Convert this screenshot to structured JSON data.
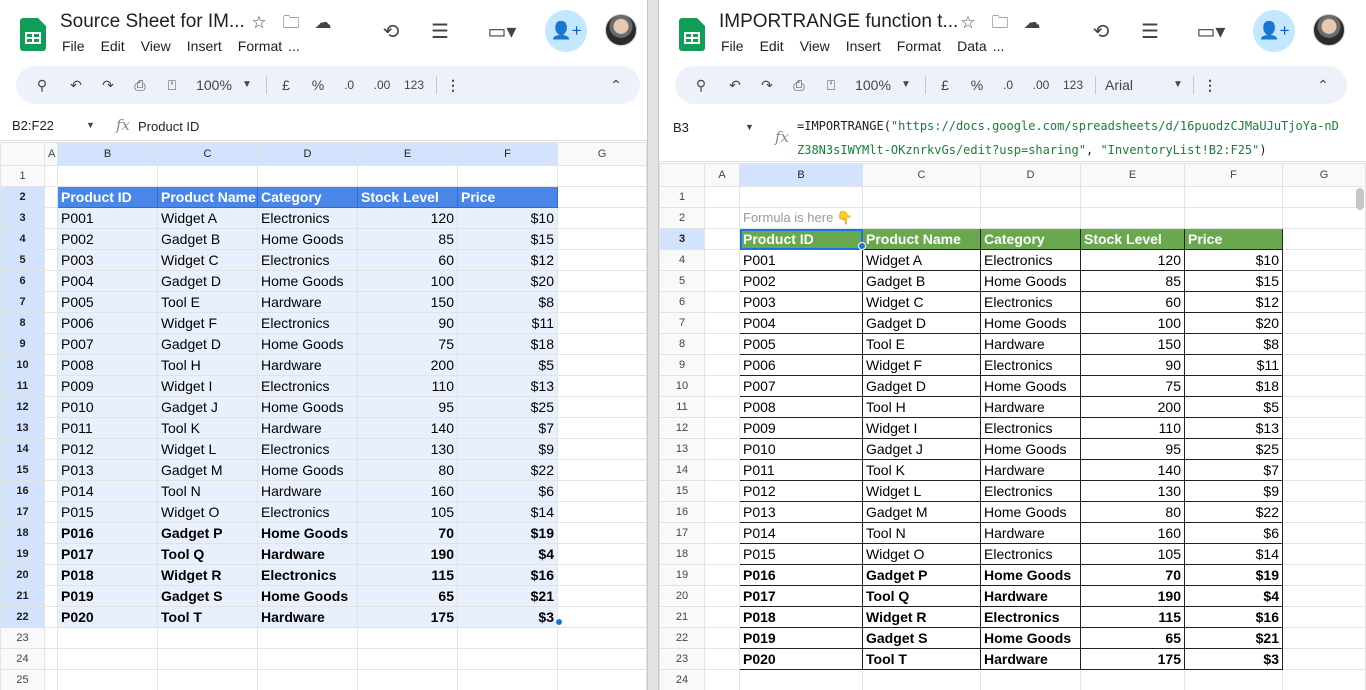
{
  "left": {
    "title": "Source Sheet for IM...",
    "menu": [
      "File",
      "Edit",
      "View",
      "Insert",
      "Format",
      "..."
    ],
    "zoom": "100%",
    "toolbar": {
      "currency": "£",
      "percent": "%",
      "dec_less": ".0",
      "dec_more": ".00",
      "format": "123"
    },
    "name_box": "B2:F22",
    "formula": "Product ID",
    "cols": [
      "A",
      "B",
      "C",
      "D",
      "E",
      "F",
      "G"
    ],
    "header": [
      "Product ID",
      "Product Name",
      "Category",
      "Stock Level",
      "Price"
    ],
    "rows": [
      [
        "P001",
        "Widget A",
        "Electronics",
        "120",
        "$10"
      ],
      [
        "P002",
        "Gadget B",
        "Home Goods",
        "85",
        "$15"
      ],
      [
        "P003",
        "Widget C",
        "Electronics",
        "60",
        "$12"
      ],
      [
        "P004",
        "Gadget D",
        "Home Goods",
        "100",
        "$20"
      ],
      [
        "P005",
        "Tool E",
        "Hardware",
        "150",
        "$8"
      ],
      [
        "P006",
        "Widget F",
        "Electronics",
        "90",
        "$11"
      ],
      [
        "P007",
        "Gadget D",
        "Home Goods",
        "75",
        "$18"
      ],
      [
        "P008",
        "Tool H",
        "Hardware",
        "200",
        "$5"
      ],
      [
        "P009",
        "Widget I",
        "Electronics",
        "110",
        "$13"
      ],
      [
        "P010",
        "Gadget J",
        "Home Goods",
        "95",
        "$25"
      ],
      [
        "P011",
        "Tool K",
        "Hardware",
        "140",
        "$7"
      ],
      [
        "P012",
        "Widget L",
        "Electronics",
        "130",
        "$9"
      ],
      [
        "P013",
        "Gadget M",
        "Home Goods",
        "80",
        "$22"
      ],
      [
        "P014",
        "Tool N",
        "Hardware",
        "160",
        "$6"
      ],
      [
        "P015",
        "Widget O",
        "Electronics",
        "105",
        "$14"
      ],
      [
        "P016",
        "Gadget P",
        "Home Goods",
        "70",
        "$19"
      ],
      [
        "P017",
        "Tool Q",
        "Hardware",
        "190",
        "$4"
      ],
      [
        "P018",
        "Widget R",
        "Electronics",
        "115",
        "$16"
      ],
      [
        "P019",
        "Gadget S",
        "Home Goods",
        "65",
        "$21"
      ],
      [
        "P020",
        "Tool T",
        "Hardware",
        "175",
        "$3"
      ]
    ],
    "bold_from": 15,
    "row_numbers": [
      "1",
      "2",
      "3",
      "4",
      "5",
      "6",
      "7",
      "8",
      "9",
      "10",
      "11",
      "12",
      "13",
      "14",
      "15",
      "16",
      "17",
      "18",
      "19",
      "20",
      "21",
      "22",
      "23",
      "24",
      "25"
    ]
  },
  "right": {
    "title": "IMPORTRANGE function t...",
    "menu": [
      "File",
      "Edit",
      "View",
      "Insert",
      "Format",
      "Data",
      "..."
    ],
    "zoom": "100%",
    "font": "Arial",
    "toolbar": {
      "currency": "£",
      "percent": "%",
      "dec_less": ".0",
      "dec_more": ".00",
      "format": "123"
    },
    "name_box": "B3",
    "formula_fn": "=IMPORTRANGE(",
    "formula_url": "\"https://docs.google.com/spreadsheets/d/16puodzCJMaUJuTjoYa-nDZ38N3sIWYMlt-OKznrkvGs/edit?usp=sharing\"",
    "formula_sep": ", ",
    "formula_range": "\"InventoryList!B2:F25\"",
    "formula_close": ")",
    "note": "Formula is here 👇",
    "cols": [
      "A",
      "B",
      "C",
      "D",
      "E",
      "F",
      "G"
    ],
    "header": [
      "Product ID",
      "Product Name",
      "Category",
      "Stock Level",
      "Price"
    ],
    "row_numbers": [
      "1",
      "2",
      "3",
      "4",
      "5",
      "6",
      "7",
      "8",
      "9",
      "10",
      "11",
      "12",
      "13",
      "14",
      "15",
      "16",
      "17",
      "18",
      "19",
      "20",
      "21",
      "22",
      "23",
      "24"
    ]
  },
  "colors": {
    "blue_header": "#4a86e8",
    "green_header": "#6aa84f",
    "selection": "#1a73e8"
  }
}
